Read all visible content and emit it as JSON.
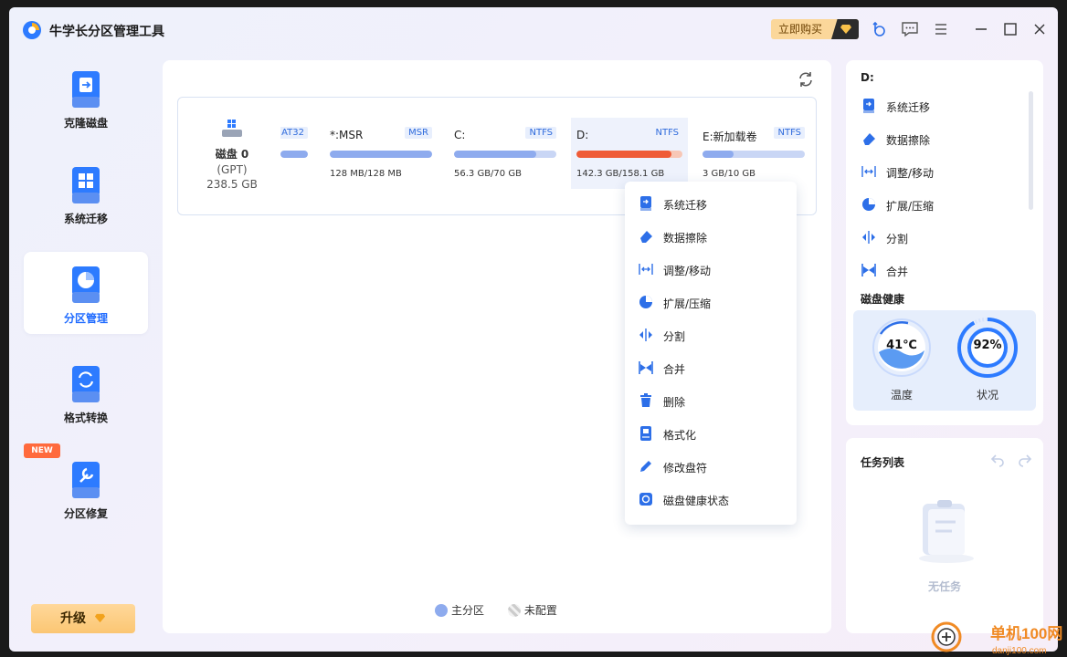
{
  "app": {
    "title": "牛学长分区管理工具",
    "buy_label": "立即购买"
  },
  "sidebar": {
    "items": [
      {
        "label": "克隆磁盘"
      },
      {
        "label": "系统迁移"
      },
      {
        "label": "分区管理"
      },
      {
        "label": "格式转换"
      },
      {
        "label": "分区修复"
      }
    ],
    "new_badge": "NEW",
    "upgrade_label": "升级"
  },
  "disk": {
    "name": "磁盘 0",
    "type": "(GPT)",
    "size": "238.5 GB",
    "partitions": [
      {
        "label": "",
        "type": "AT32",
        "usage": "",
        "fill_pct": 100
      },
      {
        "label": "*:MSR",
        "type": "MSR",
        "usage": "128 MB/128 MB",
        "fill_pct": 100
      },
      {
        "label": "C:",
        "type": "NTFS",
        "usage": "56.3 GB/70 GB",
        "fill_pct": 80
      },
      {
        "label": "D:",
        "type": "NTFS",
        "usage": "142.3 GB/158.1 GB",
        "fill_pct": 90
      },
      {
        "label": "E:新加载卷",
        "type": "NTFS",
        "usage": "3 GB/10 GB",
        "fill_pct": 30
      }
    ]
  },
  "legend": {
    "primary": "主分区",
    "unallocated": "未配置"
  },
  "context_menu": {
    "items": [
      "系统迁移",
      "数据擦除",
      "调整/移动",
      "扩展/压缩",
      "分割",
      "合并",
      "删除",
      "格式化",
      "修改盘符",
      "磁盘健康状态"
    ]
  },
  "right_panel": {
    "title": "D:",
    "items": [
      "系统迁移",
      "数据擦除",
      "调整/移动",
      "扩展/压缩",
      "分割",
      "合并"
    ],
    "health_title": "磁盘健康",
    "temperature": {
      "value": "41℃",
      "label": "温度"
    },
    "status": {
      "value": "92%",
      "label": "状况",
      "pct": 92
    }
  },
  "tasks": {
    "title": "任务列表",
    "empty_label": "无任务"
  },
  "watermark": {
    "text1": "单机100网",
    "text2": "danji100.com"
  },
  "colors": {
    "accent": "#1f6bff",
    "selected_bar": "#ef5b37",
    "bar": "#8eabee"
  }
}
